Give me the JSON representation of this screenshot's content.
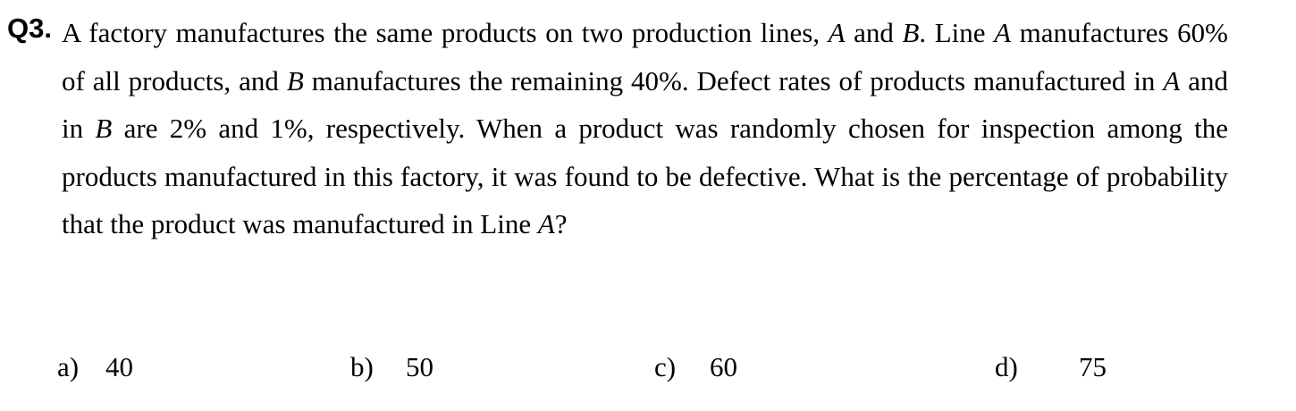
{
  "question": {
    "number": "Q3.",
    "segments": [
      {
        "text": "A factory manufactures the same products on two production lines, ",
        "italic": false
      },
      {
        "text": "A",
        "italic": true
      },
      {
        "text": " and ",
        "italic": false
      },
      {
        "text": "B",
        "italic": true
      },
      {
        "text": ". Line ",
        "italic": false
      },
      {
        "text": "A",
        "italic": true
      },
      {
        "text": " manufactures 60% of all products, and ",
        "italic": false
      },
      {
        "text": "B",
        "italic": true
      },
      {
        "text": " manufactures the remaining 40%. Defect rates of products manufactured in ",
        "italic": false
      },
      {
        "text": "A",
        "italic": true
      },
      {
        "text": " and in ",
        "italic": false
      },
      {
        "text": "B",
        "italic": true
      },
      {
        "text": " are 2% and 1%, respectively. When a product was randomly chosen for inspection among the products manufactured in this factory, it was found to be defective. What is the percentage of probability that the product was manufactured in Line ",
        "italic": false
      },
      {
        "text": "A",
        "italic": true
      },
      {
        "text": "?",
        "italic": false
      }
    ]
  },
  "options": [
    {
      "letter": "a)",
      "value": "40"
    },
    {
      "letter": "b)",
      "value": "50"
    },
    {
      "letter": "c)",
      "value": "60"
    },
    {
      "letter": "d)",
      "value": "75"
    }
  ]
}
